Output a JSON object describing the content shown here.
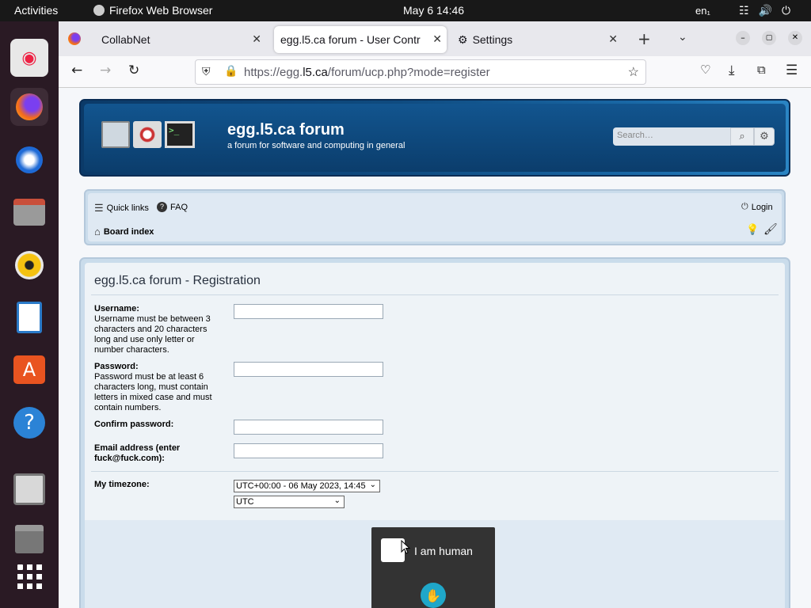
{
  "topbar": {
    "activities": "Activities",
    "app_name": "Firefox Web Browser",
    "clock": "May 6  14:46",
    "lang": "en₁"
  },
  "dock": {
    "items": [
      "help-icon",
      "firefox-icon",
      "thunderbird-icon",
      "files-icon",
      "rhythmbox-icon",
      "writer-icon",
      "app-center-icon",
      "help-icon",
      "save-icon",
      "trash-icon",
      "apps-grid-icon"
    ]
  },
  "browser": {
    "tabs": [
      {
        "label": "CollabNet"
      },
      {
        "label": "egg.l5.ca forum - User Contr"
      },
      {
        "label": "Settings"
      }
    ],
    "url": {
      "prefix": "https://egg.",
      "domain": "l5.ca",
      "suffix": "/forum/ucp.php?mode=register"
    }
  },
  "forum": {
    "title": "egg.l5.ca forum",
    "description": "a forum for software and computing in general",
    "search_placeholder": "Search…",
    "nav": {
      "quick_links": "Quick links",
      "faq": "FAQ",
      "login": "Login",
      "board_index": "Board index"
    },
    "registration": {
      "heading": "egg.l5.ca forum - Registration",
      "username_label": "Username:",
      "username_help": "Username must be between 3 characters and 20 characters long and use only letter or number characters.",
      "password_label": "Password:",
      "password_help": "Password must be at least 6 characters long, must contain letters in mixed case and must contain numbers.",
      "confirm_label": "Confirm password:",
      "email_label": "Email address (enter fuck@fuck.com):",
      "timezone_label": "My timezone:",
      "timezone_value": "UTC+00:00 - 06 May 2023, 14:45",
      "timezone_zone": "UTC"
    },
    "captcha": {
      "label": "I am human"
    }
  }
}
